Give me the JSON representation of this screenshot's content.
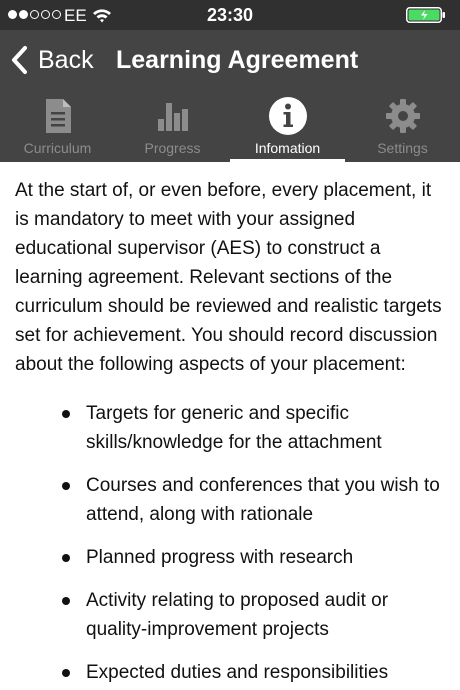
{
  "status_bar": {
    "carrier": "EE",
    "time": "23:30",
    "signal_filled": 2,
    "signal_total": 5,
    "battery_color": "#4cd964"
  },
  "nav": {
    "back_label": "Back",
    "title": "Learning Agreement"
  },
  "tabs": [
    {
      "label": "Curriculum",
      "icon": "document-icon",
      "active": false
    },
    {
      "label": "Progress",
      "icon": "bar-chart-icon",
      "active": false
    },
    {
      "label": "Infomation",
      "icon": "info-icon",
      "active": true
    },
    {
      "label": "Settings",
      "icon": "gear-icon",
      "active": false
    }
  ],
  "content": {
    "intro": "At the start of, or even before, every placement, it is mandatory to meet with your assigned educational supervisor (AES) to construct a learning agreement. Relevant sections of the curriculum should be reviewed and realistic targets set for achievement. You should record discussion about the following aspects of your placement:",
    "bullets": [
      "Targets for generic and specific skills/knowledge for the attachment",
      "Courses and conferences that you wish to attend, along with rationale",
      "Planned progress with research",
      "Activity relating to proposed audit or quality-improvement projects",
      "Expected duties and responsibilities"
    ]
  },
  "colors": {
    "nav_background": "#444444",
    "status_background": "#303030",
    "inactive_tab": "#8c8c8c",
    "active_tab": "#ffffff"
  }
}
